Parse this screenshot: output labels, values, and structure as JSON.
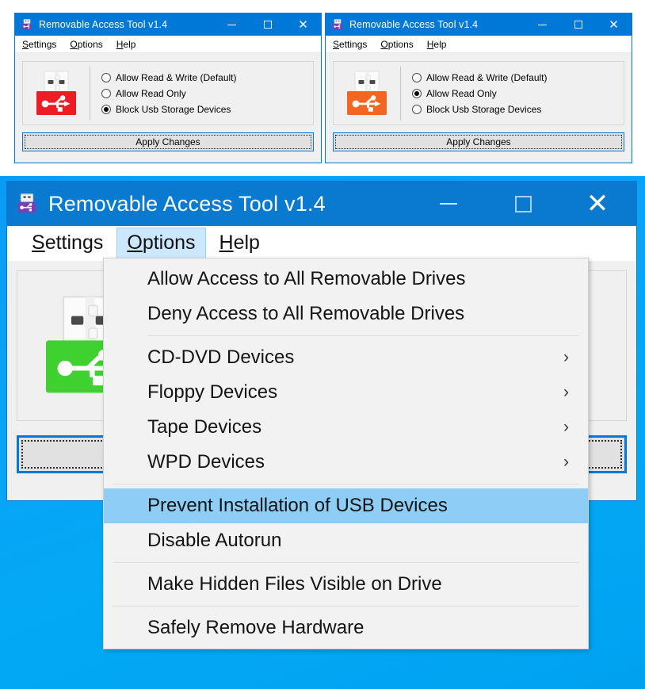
{
  "app": {
    "title": "Removable Access Tool v1.4",
    "title_icon": "usb-flash-drive-icon"
  },
  "menubar": {
    "items": [
      {
        "label": "Settings",
        "accel": "S",
        "rest": "ettings"
      },
      {
        "label": "Options",
        "accel": "O",
        "rest": "ptions"
      },
      {
        "label": "Help",
        "accel": "H",
        "rest": "elp"
      }
    ]
  },
  "window_controls": {
    "minimize": "minimize-icon",
    "maximize": "maximize-icon",
    "close": "close-icon"
  },
  "radio_options": [
    {
      "label": "Allow Read & Write (Default)"
    },
    {
      "label": "Allow Read Only"
    },
    {
      "label": "Block Usb Storage Devices"
    }
  ],
  "apply_button": {
    "label": "Apply Changes"
  },
  "windows": [
    {
      "id": "window-blocked",
      "title": "Removable Access Tool v1.4",
      "selected_index": 2,
      "usb_icon_color": "#ee1c25",
      "usb_icon_color_light": "#f4403f"
    },
    {
      "id": "window-readonly",
      "title": "Removable Access Tool v1.4",
      "selected_index": 1,
      "usb_icon_color": "#f26522",
      "usb_icon_color_light": "#f57b3c"
    },
    {
      "id": "window-allowed",
      "title": "Removable Access Tool v1.4",
      "selected_index": 0,
      "usb_icon_color": "#3ed12f",
      "usb_icon_color_light": "#55d945"
    }
  ],
  "options_menu": {
    "open_from": "Options",
    "items": [
      {
        "label": "Allow Access to All Removable Drives",
        "submenu": false,
        "highlighted": false,
        "separator_after": false
      },
      {
        "label": "Deny Access to All Removable Drives",
        "submenu": false,
        "highlighted": false,
        "separator_after": true
      },
      {
        "label": "CD-DVD Devices",
        "submenu": true,
        "highlighted": false,
        "separator_after": false
      },
      {
        "label": "Floppy Devices",
        "submenu": true,
        "highlighted": false,
        "separator_after": false
      },
      {
        "label": "Tape Devices",
        "submenu": true,
        "highlighted": false,
        "separator_after": false
      },
      {
        "label": "WPD Devices",
        "submenu": true,
        "highlighted": false,
        "separator_after": true
      },
      {
        "label": "Prevent Installation of USB Devices",
        "submenu": false,
        "highlighted": true,
        "separator_after": false
      },
      {
        "label": "Disable Autorun",
        "submenu": false,
        "highlighted": false,
        "separator_after": true
      },
      {
        "label": "Make Hidden Files Visible on Drive",
        "submenu": false,
        "highlighted": false,
        "separator_after": true
      },
      {
        "label": "Safely Remove Hardware",
        "submenu": false,
        "highlighted": false,
        "separator_after": false
      }
    ],
    "submenu_arrow_glyph": "›"
  },
  "colors": {
    "titlebar_blue": "#0078d7",
    "titlebar_blue_large": "#0a7ad1",
    "menu_highlight": "#8ecdf5",
    "menubar_active": "#cce8ff",
    "desktop_blue": "#03a9f4",
    "window_face": "#f0f0f0"
  },
  "glyphs": {
    "minimize": "–",
    "maximize": "□",
    "close": "✕"
  }
}
